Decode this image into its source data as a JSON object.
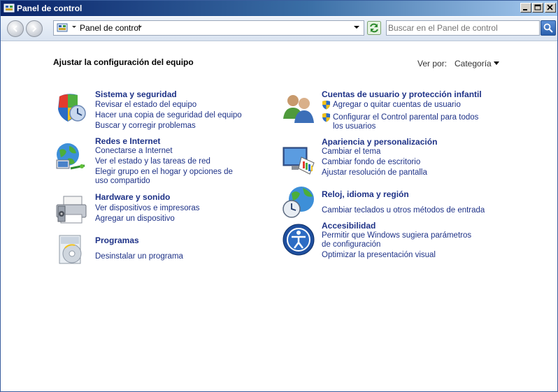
{
  "window": {
    "title": "Panel de control"
  },
  "toolbar": {
    "address_crumb": "Panel de control",
    "search_placeholder": "Buscar en el Panel de control"
  },
  "page": {
    "heading": "Ajustar la configuración del equipo",
    "view_by_label": "Ver por:",
    "view_by_value": "Categoría"
  },
  "categories": {
    "sistema": {
      "title": "Sistema y seguridad",
      "links": [
        "Revisar el estado del equipo",
        "Hacer una copia de seguridad del equipo",
        "Buscar y corregir problemas"
      ]
    },
    "redes": {
      "title": "Redes e Internet",
      "links": [
        "Conectarse a Internet",
        "Ver el estado y las tareas de red",
        "Elegir grupo en el hogar y opciones de uso compartido"
      ]
    },
    "hardware": {
      "title": "Hardware y sonido",
      "links": [
        "Ver dispositivos e impresoras",
        "Agregar un dispositivo"
      ]
    },
    "programas": {
      "title": "Programas",
      "links": [
        "Desinstalar un programa"
      ]
    },
    "cuentas": {
      "title": "Cuentas de usuario y protección infantil",
      "links": [
        "Agregar o quitar cuentas de usuario",
        "Configurar el Control parental para todos los usuarios"
      ]
    },
    "apariencia": {
      "title": "Apariencia y personalización",
      "links": [
        "Cambiar el tema",
        "Cambiar fondo de escritorio",
        "Ajustar resolución de pantalla"
      ]
    },
    "reloj": {
      "title": "Reloj, idioma y región",
      "links": [
        "Cambiar teclados u otros métodos de entrada"
      ]
    },
    "accesibilidad": {
      "title": "Accesibilidad",
      "links": [
        "Permitir que Windows sugiera parámetros de configuración",
        "Optimizar la presentación visual"
      ]
    }
  }
}
